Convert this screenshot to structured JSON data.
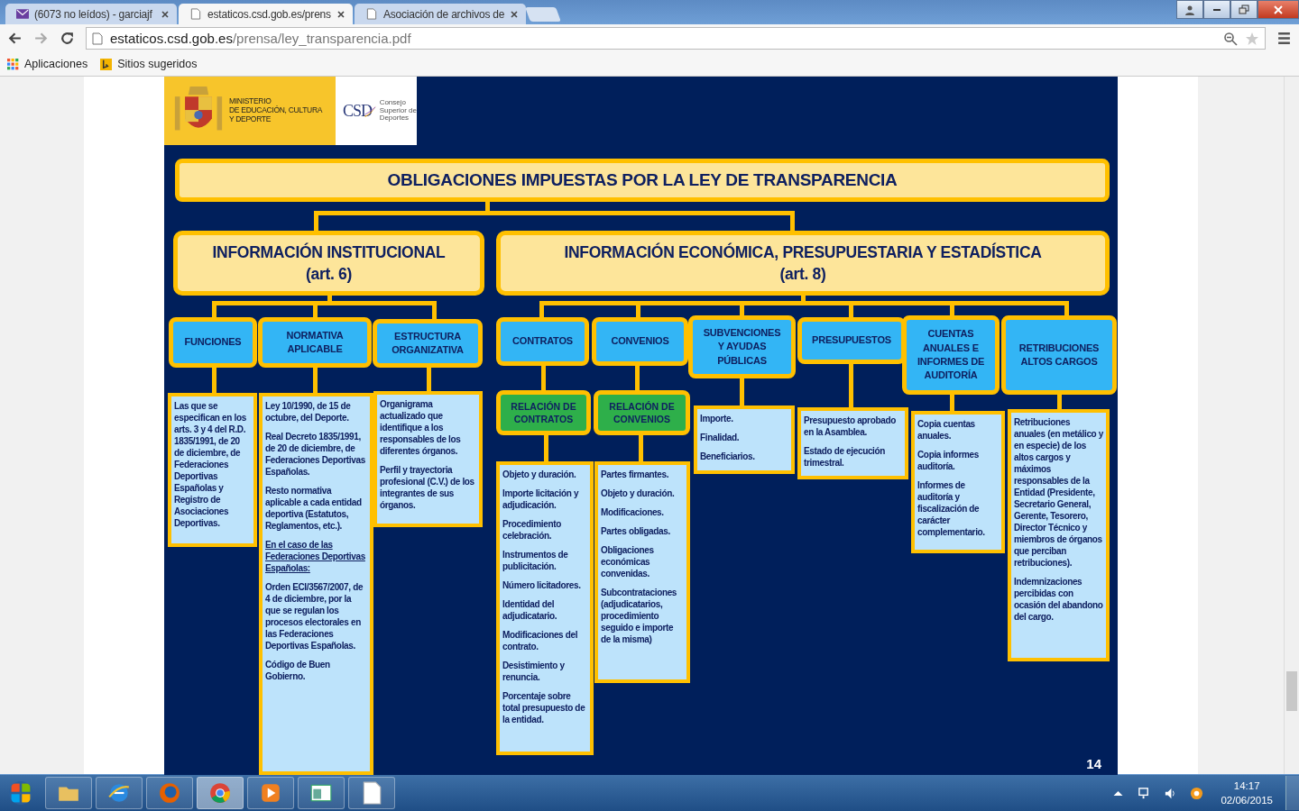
{
  "browser": {
    "tabs": [
      {
        "kind": "mail",
        "title": "(6073 no leídos) - garciajf",
        "selected": false
      },
      {
        "kind": "page",
        "title": "estaticos.csd.gob.es/prens",
        "selected": true
      },
      {
        "kind": "page",
        "title": "Asociación de archivos de",
        "selected": false
      }
    ],
    "address": {
      "host": "estaticos.csd.gob.es",
      "path": "/prensa/ley_transparencia.pdf"
    },
    "bookmarks": [
      {
        "kind": "apps",
        "label": "Aplicaciones"
      },
      {
        "kind": "bing",
        "label": "Sitios sugeridos"
      }
    ]
  },
  "slide": {
    "ministry": [
      "MINISTERIO",
      "DE EDUCACIÓN, CULTURA",
      "Y DEPORTE"
    ],
    "csd": {
      "mark": "CSD",
      "name": [
        "Consejo",
        "Superior de",
        "Deportes"
      ]
    },
    "title": "OBLIGACIONES IMPUESTAS POR LA LEY DE TRANSPARENCIA",
    "sections": [
      {
        "title": "INFORMACIÓN INSTITUCIONAL",
        "subtitle": "(art. 6)",
        "categories": [
          {
            "label": "FUNCIONES",
            "items": [
              {
                "text": "Las que se especifican en los arts. 3 y 4 del R.D. 1835/1991, de 20 de diciembre, de Federaciones Deportivas Españolas y Registro de Asociaciones Deportivas.",
                "underlined": false
              }
            ]
          },
          {
            "label": "NORMATIVA\nAPLICABLE",
            "items": [
              {
                "text": "Ley 10/1990, de 15 de octubre, del Deporte.",
                "underlined": false
              },
              {
                "text": "Real Decreto 1835/1991, de 20 de diciembre, de Federaciones Deportivas Españolas.",
                "underlined": false
              },
              {
                "text": "Resto normativa aplicable a cada entidad deportiva (Estatutos, Reglamentos, etc.).",
                "underlined": false
              },
              {
                "text": "En el caso de las Federaciones Deportivas Españolas:",
                "underlined": true
              },
              {
                "text": "Orden ECI/3567/2007, de 4 de diciembre, por la que se regulan los procesos electorales en las Federaciones Deportivas Españolas.",
                "underlined": false
              },
              {
                "text": "Código de Buen Gobierno.",
                "underlined": false
              }
            ]
          },
          {
            "label": "ESTRUCTURA\nORGANIZATIVA",
            "items": [
              {
                "text": "Organigrama actualizado que identifique a los responsables de los diferentes órganos.",
                "underlined": false
              },
              {
                "text": "Perfil y trayectoria profesional (C.V.) de los integrantes de sus órganos.",
                "underlined": false
              }
            ]
          }
        ]
      },
      {
        "title": "INFORMACIÓN ECONÓMICA, PRESUPUESTARIA Y ESTADÍSTICA",
        "subtitle": "(art. 8)",
        "categories": [
          {
            "label": "CONTRATOS",
            "relation": "RELACIÓN DE\nCONTRATOS",
            "items": [
              {
                "text": "Objeto y duración.",
                "underlined": false
              },
              {
                "text": "Importe licitación y adjudicación.",
                "underlined": false
              },
              {
                "text": "Procedimiento celebración.",
                "underlined": false
              },
              {
                "text": "Instrumentos de publicitación.",
                "underlined": false
              },
              {
                "text": "Número licitadores.",
                "underlined": false
              },
              {
                "text": "Identidad del adjudicatario.",
                "underlined": false
              },
              {
                "text": "Modificaciones del contrato.",
                "underlined": false
              },
              {
                "text": "Desistimiento y renuncia.",
                "underlined": false
              },
              {
                "text": "Porcentaje sobre total presupuesto de la entidad.",
                "underlined": false
              }
            ]
          },
          {
            "label": "CONVENIOS",
            "relation": "RELACIÓN DE\nCONVENIOS",
            "items": [
              {
                "text": "Partes firmantes.",
                "underlined": false
              },
              {
                "text": "Objeto y duración.",
                "underlined": false
              },
              {
                "text": "Modificaciones.",
                "underlined": false
              },
              {
                "text": "Partes obligadas.",
                "underlined": false
              },
              {
                "text": "Obligaciones económicas convenidas.",
                "underlined": false
              },
              {
                "text": "Subcontrataciones (adjudicatarios, procedimiento seguido e importe de la misma)",
                "underlined": false
              }
            ]
          },
          {
            "label": "SUBVENCIONES\nY AYUDAS\nPÚBLICAS",
            "items": [
              {
                "text": "Importe.",
                "underlined": false
              },
              {
                "text": "Finalidad.",
                "underlined": false
              },
              {
                "text": "Beneficiarios.",
                "underlined": false
              }
            ]
          },
          {
            "label": "PRESUPUESTOS",
            "items": [
              {
                "text": "Presupuesto aprobado en la Asamblea.",
                "underlined": false
              },
              {
                "text": "Estado de ejecución trimestral.",
                "underlined": false
              }
            ]
          },
          {
            "label": "CUENTAS\nANUALES E\nINFORMES DE\nAUDITORÍA",
            "items": [
              {
                "text": "Copia cuentas anuales.",
                "underlined": false
              },
              {
                "text": "Copia informes auditoría.",
                "underlined": false
              },
              {
                "text": "Informes de auditoría y fiscalización de carácter complementario.",
                "underlined": false
              }
            ]
          },
          {
            "label": "RETRIBUCIONES\nALTOS CARGOS",
            "items": [
              {
                "text": "Retribuciones anuales (en metálico y en especie) de los altos cargos y máximos responsables de la Entidad (Presidente, Secretario General, Gerente, Tesorero, Director Técnico y miembros de órganos que perciban retribuciones).",
                "underlined": false
              },
              {
                "text": "Indemnizaciones percibidas con ocasión del abandono del cargo.",
                "underlined": false
              }
            ]
          }
        ]
      }
    ],
    "page_number": "14"
  },
  "taskbar": {
    "apps": [
      {
        "kind": "folder",
        "selected": false
      },
      {
        "kind": "ie",
        "selected": false
      },
      {
        "kind": "firefox",
        "selected": false
      },
      {
        "kind": "chrome",
        "selected": true
      },
      {
        "kind": "media",
        "selected": false
      },
      {
        "kind": "window",
        "selected": false
      },
      {
        "kind": "document",
        "selected": false
      }
    ],
    "time": "14:17",
    "date": "02/06/2015"
  }
}
